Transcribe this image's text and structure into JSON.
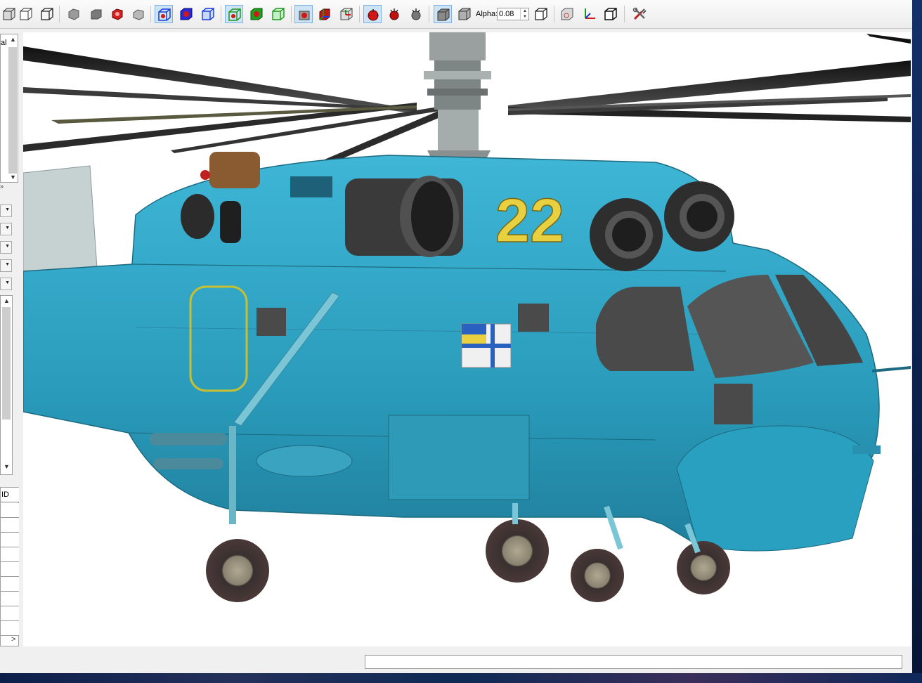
{
  "toolbar": {
    "alpha_label": "Alpha:",
    "alpha_value": "0.08",
    "groups": [
      {
        "buttons": [
          "view-solid-icon",
          "view-wire-icon",
          "view-box-icon"
        ]
      },
      {
        "buttons": [
          "shade-gray-icon",
          "shade-flat-icon",
          "shade-red-icon",
          "shade-cube-icon"
        ]
      },
      {
        "buttons": [
          "blue-wire-icon",
          "blue-solid-icon",
          "blue-box-icon"
        ]
      },
      {
        "buttons": [
          "green-wire-icon",
          "green-solid-icon",
          "green-box-icon"
        ]
      },
      {
        "buttons": [
          "red-target-icon",
          "rgb-cube-icon",
          "rgb-box-icon"
        ]
      },
      {
        "buttons": [
          "red-light-icon",
          "red-light-drop-icon",
          "gray-light-icon"
        ]
      },
      {
        "buttons": [
          "solid-box-icon",
          "wire-box-icon"
        ]
      },
      {
        "buttons": [
          "box-outline-icon",
          "texture-box-icon",
          "axes-icon",
          "cube-outline-icon"
        ]
      },
      {
        "buttons": [
          "tools-icon"
        ]
      }
    ]
  },
  "left_panel": {
    "top_list_text": "al",
    "grid_header": "ID",
    "scroll_arrow_right": ">"
  },
  "viewport": {
    "model_marking": "22",
    "colors": {
      "hull": "#2ea3c3",
      "marking": "#e8d040",
      "window": "#4a4a4a"
    }
  },
  "status": {
    "message": ""
  }
}
